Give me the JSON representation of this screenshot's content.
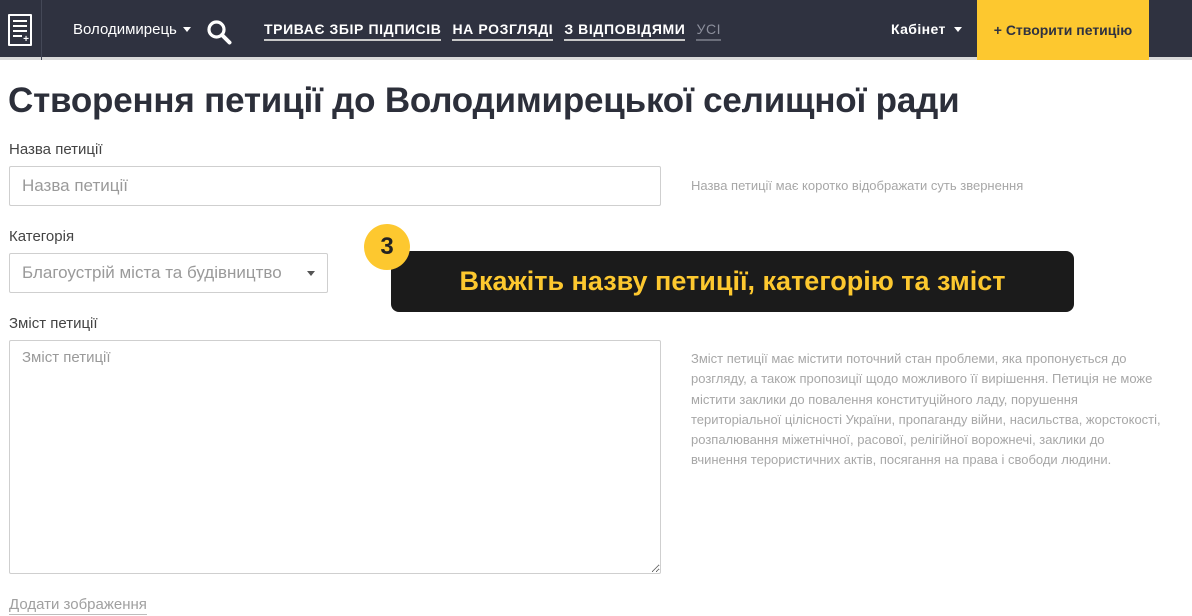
{
  "navbar": {
    "city": "Володимирець",
    "links": [
      {
        "label": "ТРИВАЄ ЗБІР ПІДПИСІВ"
      },
      {
        "label": "НА РОЗГЛЯДІ"
      },
      {
        "label": "З ВІДПОВІДЯМИ"
      },
      {
        "label": "УСІ"
      }
    ],
    "cabinet": "Кабінет",
    "create_button": "+ Створити петицію",
    "accent_color": "#fdc82f",
    "bg_color": "#2f3240",
    "icons": [
      "document-logo-icon",
      "search-icon",
      "caret-down-icon"
    ]
  },
  "page": {
    "title": "Створення петиції до Володимирецької селищної ради"
  },
  "form": {
    "name_label": "Назва петиції",
    "name_placeholder": "Назва петиції",
    "name_hint": "Назва петиції має коротко відображати суть звернення",
    "category_label": "Категорія",
    "category_value": "Благоустрій міста та будівництво",
    "content_label": "Зміст петиції",
    "content_placeholder": "Зміст петиції",
    "content_hint": "Зміст петиції має містити поточний стан проблеми, яка пропонується до розгляду, а також пропозиції щодо можливого її вирішення. Петиція не може містити заклики до повалення конституційного ладу, порушення територіальної цілісності України, пропаганду війни, насильства, жорстокості, розпалювання міжетнічної, расової, релігійної ворожнечі, заклики до вчинення терористичних актів, посягання на права і свободи людини.",
    "add_image": "Додати зображення"
  },
  "overlay": {
    "step_number": "3",
    "text": "Вкажіть назву петиції, категорію та зміст"
  }
}
